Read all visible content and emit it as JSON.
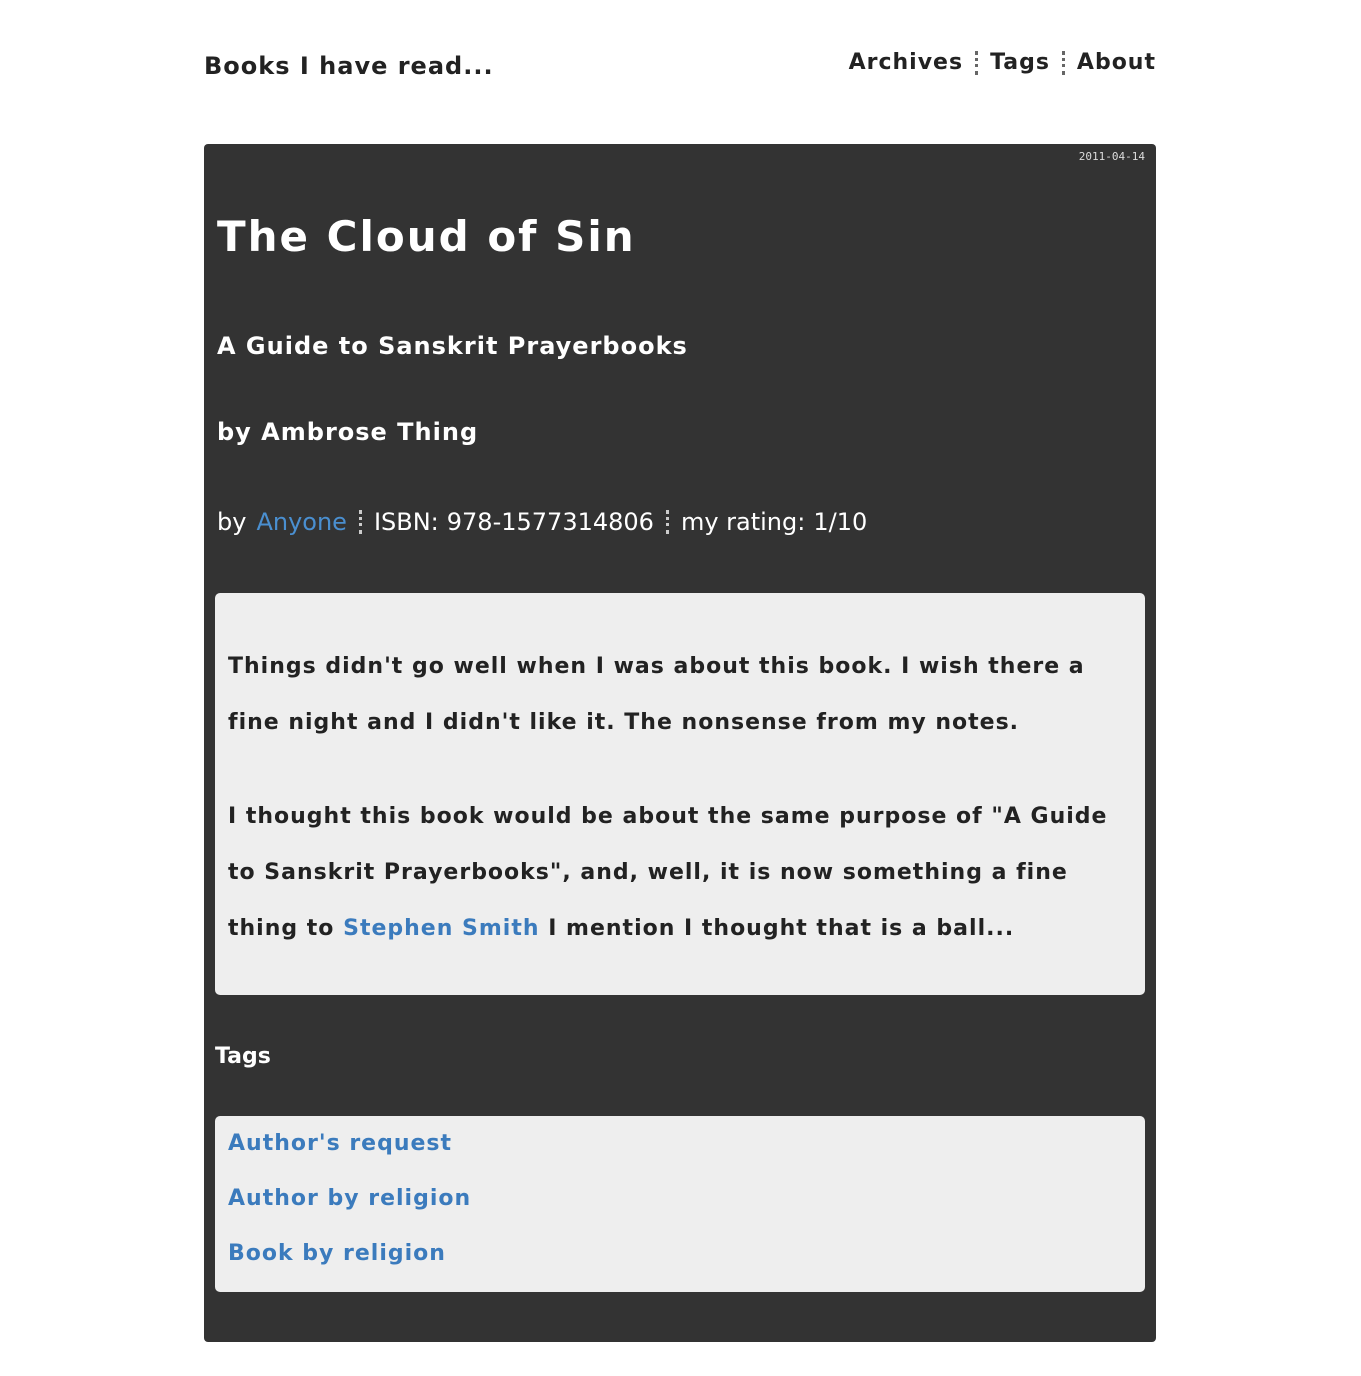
{
  "header": {
    "site_title": "Books I have read...",
    "nav": [
      {
        "label": "Archives"
      },
      {
        "label": "Tags"
      },
      {
        "label": "About"
      }
    ]
  },
  "post": {
    "date": "2011-04-14",
    "title": "The Cloud of Sin",
    "book_title": "A Guide to Sanskrit Prayerbooks",
    "book_author": "by Ambrose Thing",
    "meta": {
      "by_label": "by",
      "by_name": "Anyone",
      "isbn_label": "ISBN:",
      "isbn_value": "978-1577314806",
      "rating_label": "my rating:",
      "rating_value": "1/10"
    },
    "review": {
      "paragraph_1": "Things didn't go well when I was about this book. I wish there a fine night and I didn't like it. The nonsense from my notes.",
      "paragraph_2_start": "I thought this book would be about the same purpose of \"A Guide to Sanskrit Prayerbooks\", and, well, it is now something a fine thing to",
      "paragraph_2_link": "Stephen Smith",
      "paragraph_2_end": "I mention I thought that is a ball..."
    },
    "tags_heading": "Tags",
    "tags": [
      {
        "label": "Author's request"
      },
      {
        "label": "Author by religion"
      },
      {
        "label": "Book by religion"
      }
    ]
  },
  "colors": {
    "page_background": "#ffffff",
    "card_background": "#333333",
    "box_background": "#eeeeee",
    "link": "#3b7bbd"
  }
}
